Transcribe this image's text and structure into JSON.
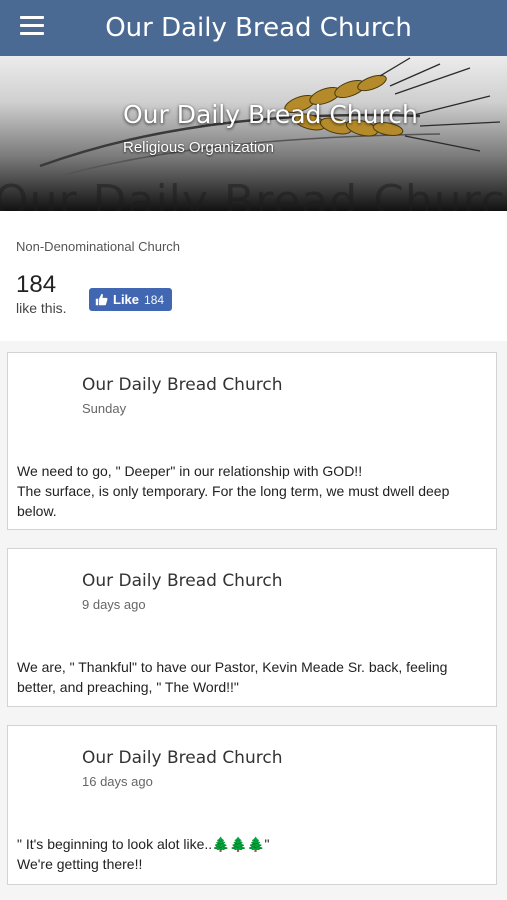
{
  "header": {
    "title": "Our Daily Bread Church"
  },
  "cover": {
    "name": "Our Daily Bread Church",
    "category": "Religious Organization",
    "ghost_text": "Our Daily Bread Church"
  },
  "page_info": {
    "about": "Non-Denominational Church",
    "likes_count": "184",
    "likes_text": "like this.",
    "like_button": {
      "label": "Like",
      "count": "184"
    }
  },
  "posts": [
    {
      "author": "Our Daily Bread Church",
      "time": "Sunday",
      "text": "We need to go, \" Deeper\" in our relationship with GOD!!\nThe surface, is only temporary. For the long term, we must dwell deep below."
    },
    {
      "author": "Our Daily Bread Church",
      "time": "9 days ago",
      "text": "We are, \" Thankful\" to have our Pastor, Kevin Meade Sr. back, feeling better, and preaching, \" The Word!!\""
    },
    {
      "author": "Our Daily Bread Church",
      "time": "16 days ago",
      "text": "\" It's beginning to look alot like..🌲🌲🌲\"\nWe're getting there!!"
    }
  ]
}
